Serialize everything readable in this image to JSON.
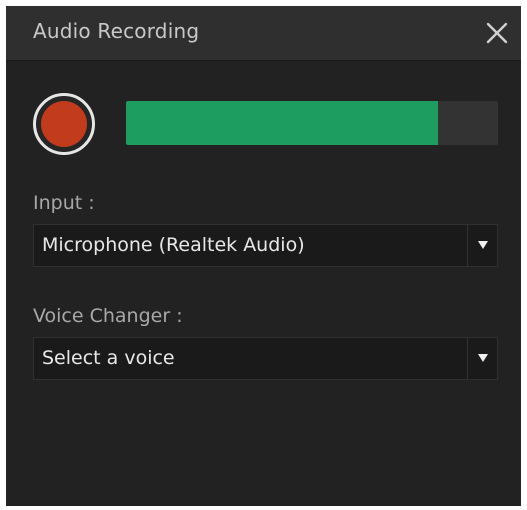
{
  "window": {
    "title": "Audio Recording",
    "close_icon": "close-icon"
  },
  "recorder": {
    "record_icon": "record-icon",
    "level_fraction": 0.84,
    "colors": {
      "record": "#c23b1c",
      "level": "#1d9e60"
    }
  },
  "input": {
    "label": "Input :",
    "selected": "Microphone (Realtek Audio)",
    "arrow_icon": "dropdown-arrow-icon"
  },
  "voice_changer": {
    "label": "Voice Changer :",
    "selected": "Select a voice",
    "arrow_icon": "dropdown-arrow-icon"
  }
}
